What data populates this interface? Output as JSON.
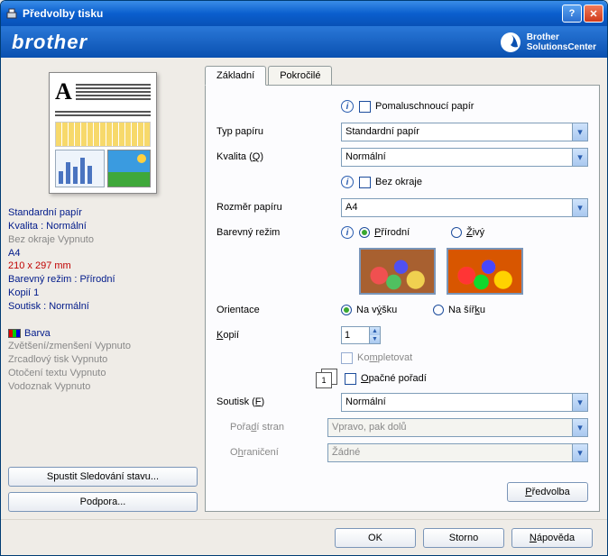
{
  "window": {
    "title": "Předvolby tisku"
  },
  "brand": {
    "logo": "brother",
    "sc_line1": "Brother",
    "sc_line2": "SolutionsCenter"
  },
  "tabs": {
    "basic": "Základní",
    "advanced": "Pokročilé"
  },
  "panel": {
    "paper_type_lbl": "Typ papíru",
    "quality_lbl": "Kvalita (Q)",
    "paper_size_lbl": "Rozměr papíru",
    "color_mode_lbl": "Barevný režim",
    "orientation_lbl": "Orientace",
    "copies_lbl": "Kopií",
    "multipage_lbl": "Soutisk (F)",
    "page_order_lbl": "Pořadí stran",
    "border_lbl": "Ohraničení",
    "slow_dry": "Pomaluschnoucí papír",
    "borderless": "Bez okraje",
    "paper_type_val": "Standardní papír",
    "quality_val": "Normální",
    "paper_size_val": "A4",
    "color_natural": "Přírodní",
    "color_vivid": "Živý",
    "orient_portrait": "Na výšku",
    "orient_landscape": "Na šířku",
    "copies_val": "1",
    "collate": "Kompletovat",
    "reverse": "Opačné pořadí",
    "multipage_val": "Normální",
    "page_order_val": "Vpravo, pak dolů",
    "border_val": "Žádné",
    "default_btn": "Předvolba"
  },
  "status": {
    "paper_type": "Standardní papír",
    "quality": "Kvalita : Normální",
    "border": "Bez okraje Vypnuto",
    "size": "A4",
    "dims": "210 x 297 mm",
    "color_mode": "Barevný režim : Přírodní",
    "copies": "Kopií 1",
    "multipage": "Soutisk : Normální",
    "color_lbl": "Barva",
    "scaling": "Zvětšení/zmenšení Vypnuto",
    "mirror": "Zrcadlový tisk Vypnuto",
    "rotate": "Otočení textu Vypnuto",
    "watermark": "Vodoznak Vypnuto"
  },
  "left_buttons": {
    "status": "Spustit Sledování stavu...",
    "support": "Podpora..."
  },
  "bottom": {
    "ok": "OK",
    "cancel": "Storno",
    "help": "Nápověda"
  }
}
